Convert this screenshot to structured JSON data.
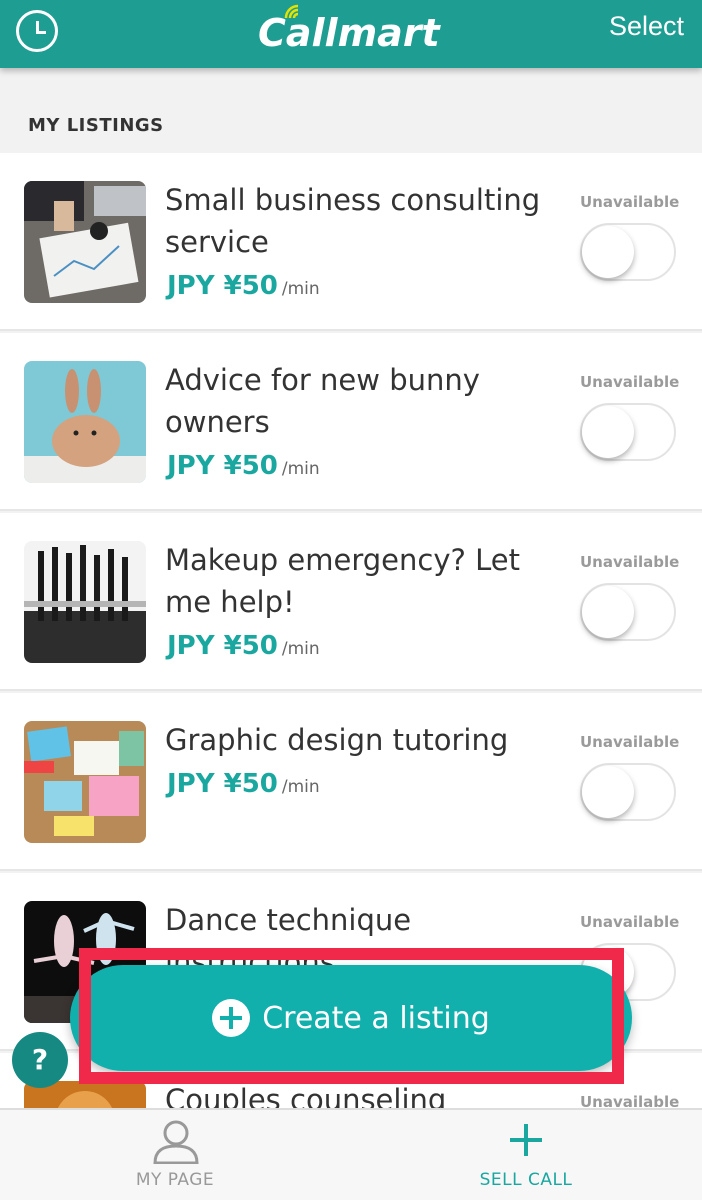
{
  "header": {
    "logo_text": "Callmart",
    "select_label": "Select",
    "history_icon": "clock-icon"
  },
  "section_title": "MY LISTINGS",
  "listings": [
    {
      "title": "Small business consulting service",
      "price": "JPY ¥50",
      "unit": "/min",
      "status": "Unavailable",
      "available": false,
      "image": "business-desk-photo"
    },
    {
      "title": "Advice for new bunny owners",
      "price": "JPY ¥50",
      "unit": "/min",
      "status": "Unavailable",
      "available": false,
      "image": "bunny-photo"
    },
    {
      "title": "Makeup emergency? Let me help!",
      "price": "JPY ¥50",
      "unit": "/min",
      "status": "Unavailable",
      "available": false,
      "image": "makeup-brushes-photo"
    },
    {
      "title": "Graphic design tutoring",
      "price": "JPY ¥50",
      "unit": "/min",
      "status": "Unavailable",
      "available": false,
      "image": "design-sticky-notes-photo"
    },
    {
      "title": "Dance technique instructions",
      "price": "",
      "unit": "",
      "status": "Unavailable",
      "available": false,
      "image": "ballet-dancers-photo"
    },
    {
      "title": "Couples counseling",
      "price": "",
      "unit": "",
      "status": "Unavailable",
      "available": false,
      "image": "couple-silhouette-photo"
    }
  ],
  "create_button": {
    "label": "Create a listing",
    "icon": "plus-circle-icon"
  },
  "help_button": {
    "label": "?"
  },
  "tabbar": {
    "my_page": {
      "label": "MY PAGE",
      "icon": "person-icon"
    },
    "sell_call": {
      "label": "SELL CALL",
      "icon": "plus-icon"
    }
  },
  "colors": {
    "brand": "#1e9e93",
    "price": "#1aa7a0",
    "button": "#12b0ad",
    "highlight": "#f0294a"
  }
}
